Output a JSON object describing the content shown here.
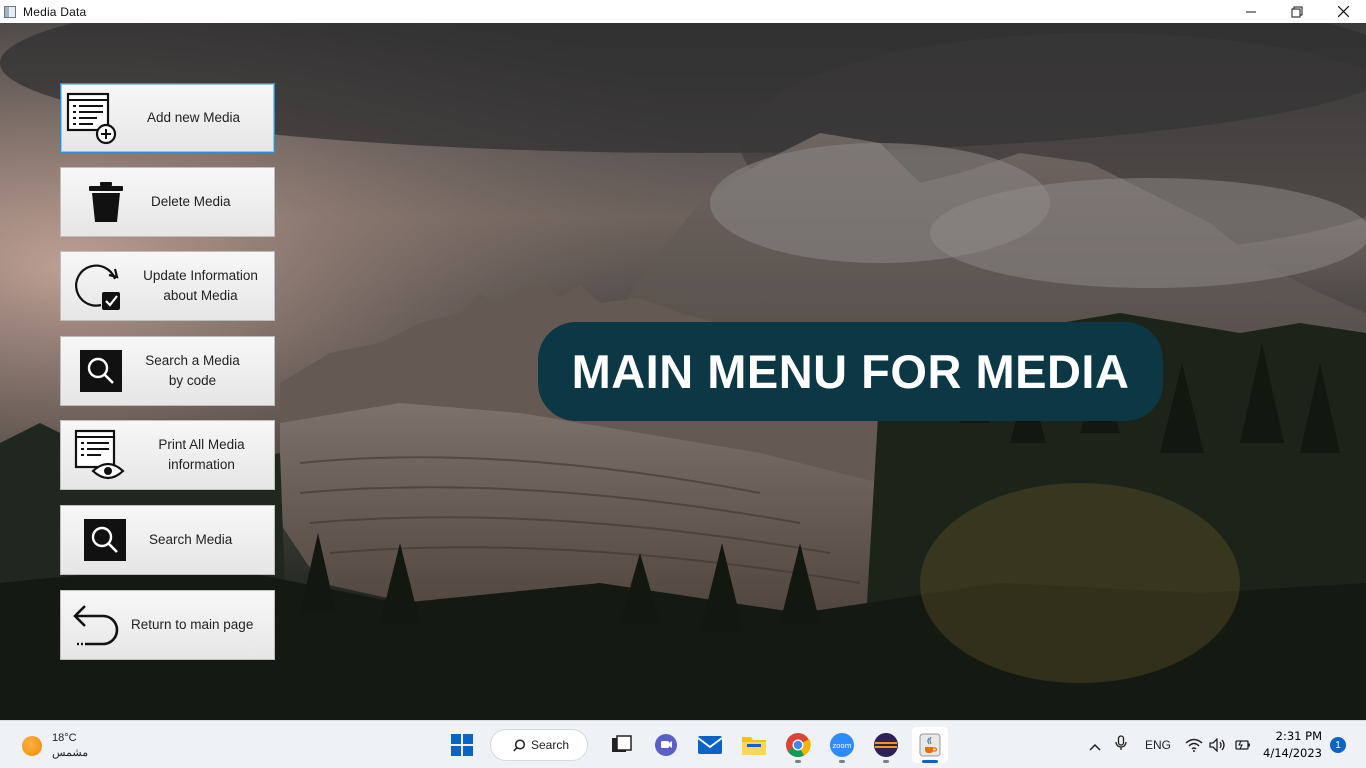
{
  "window": {
    "title": "Media  Data"
  },
  "menu": {
    "items": [
      {
        "label": "Add new Media",
        "icon": "add-list-icon"
      },
      {
        "label": "Delete Media",
        "icon": "trash-icon"
      },
      {
        "label": "Update Information about Media",
        "icon": "refresh-check-icon"
      },
      {
        "label": "Search a Media by code",
        "icon": "search-icon"
      },
      {
        "label": "Print All Media information",
        "icon": "list-eye-icon"
      },
      {
        "label": "Search Media",
        "icon": "search-icon"
      },
      {
        "label": "Return to main page",
        "icon": "return-arrow-icon"
      }
    ]
  },
  "banner": {
    "text": "MAIN MENU FOR MEDIA"
  },
  "taskbar": {
    "weather": {
      "temp": "18°C",
      "desc": "مشمس"
    },
    "search_label": "Search",
    "language": "ENG",
    "time": "2:31 PM",
    "date": "4/14/2023",
    "notification_count": "1"
  },
  "colors": {
    "banner_bg": "#0c3845",
    "accent": "#0a64c8"
  }
}
